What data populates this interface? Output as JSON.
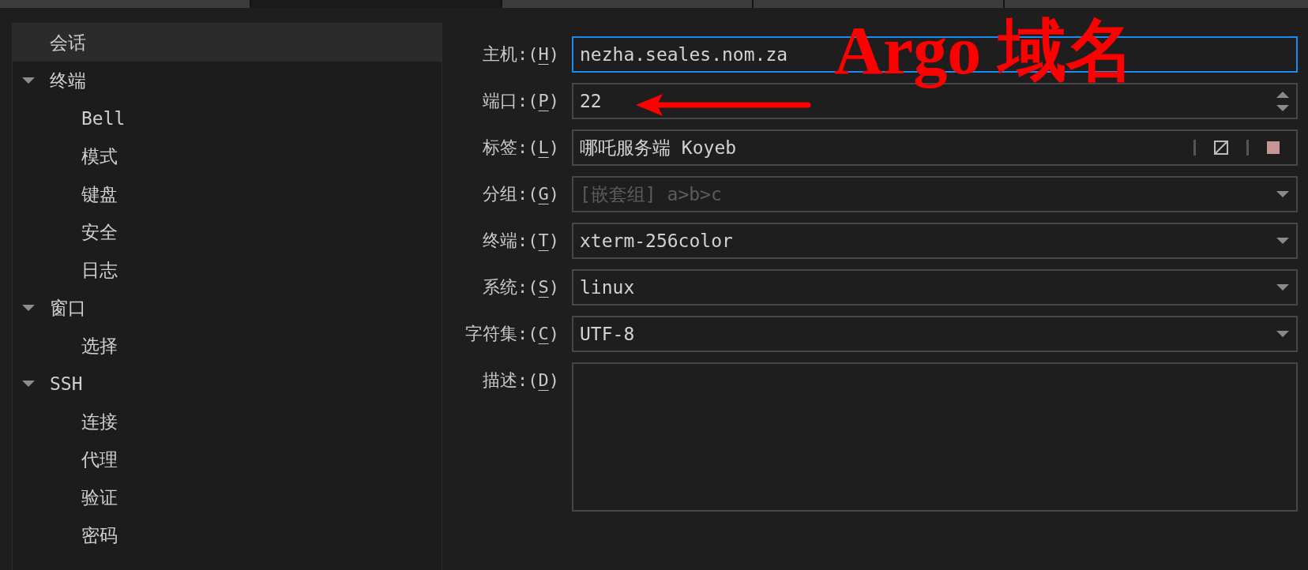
{
  "tabs": [
    {
      "selected": false
    },
    {
      "selected": true
    },
    {
      "selected": false
    },
    {
      "selected": false
    },
    {
      "selected": false
    }
  ],
  "sidebar": {
    "items": [
      {
        "label": "会话",
        "selected": true
      },
      {
        "label": "终端",
        "selected": false,
        "expanded": true,
        "children": [
          {
            "label": "Bell",
            "selected": false
          },
          {
            "label": "模式",
            "selected": false
          },
          {
            "label": "键盘",
            "selected": false
          },
          {
            "label": "安全",
            "selected": false
          },
          {
            "label": "日志",
            "selected": false
          }
        ]
      },
      {
        "label": "窗口",
        "selected": false,
        "expanded": true,
        "children": [
          {
            "label": "选择",
            "selected": false
          }
        ]
      },
      {
        "label": "SSH",
        "selected": false,
        "expanded": true,
        "children": [
          {
            "label": "连接",
            "selected": false
          },
          {
            "label": "代理",
            "selected": false
          },
          {
            "label": "验证",
            "selected": false
          },
          {
            "label": "密码",
            "selected": false
          }
        ]
      }
    ]
  },
  "form": {
    "fields": [
      {
        "kind": "text",
        "label": "主机:(",
        "accelerator": "H",
        "label_end": ")",
        "value": "nezha.seales.nom.za",
        "focused": true
      },
      {
        "kind": "spin",
        "label": "端口:(",
        "accelerator": "P",
        "label_end": ")",
        "value": "22",
        "focused": false
      },
      {
        "kind": "tag",
        "label": "标签:(",
        "accelerator": "L",
        "label_end": ")",
        "value": "哪吒服务端 Koyeb",
        "color": "#c89595",
        "focused": false
      },
      {
        "kind": "combo",
        "label": "分组:(",
        "accelerator": "G",
        "label_end": ")",
        "placeholder": "[嵌套组] a>b>c",
        "focused": false
      },
      {
        "kind": "combo",
        "label": "终端:(",
        "accelerator": "T",
        "label_end": ")",
        "value": "xterm-256color",
        "focused": false
      },
      {
        "kind": "combo",
        "label": "系统:(",
        "accelerator": "S",
        "label_end": ")",
        "value": "linux",
        "focused": false
      },
      {
        "kind": "combo",
        "label": "字符集:(",
        "accelerator": "C",
        "label_end": ")",
        "value": "UTF-8",
        "focused": false
      },
      {
        "kind": "textarea",
        "label": "描述:(",
        "accelerator": "D",
        "label_end": ")",
        "focused": false
      }
    ]
  },
  "annotation": {
    "text": "Argo 域名"
  }
}
